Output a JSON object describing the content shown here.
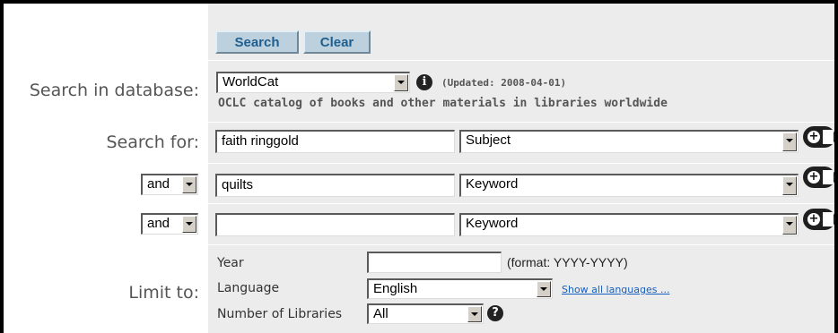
{
  "buttons": {
    "search": "Search",
    "clear": "Clear"
  },
  "database": {
    "label": "Search in database:",
    "selected": "WorldCat",
    "updated": "(Updated: 2008-04-01)",
    "description": "OCLC catalog of books and other materials in libraries worldwide",
    "info_icon": "info-icon"
  },
  "search_rows": [
    {
      "label": "Search for:",
      "term": "faith ringgold",
      "index": "Subject"
    },
    {
      "operator": "and",
      "term": "quilts",
      "index": "Keyword"
    },
    {
      "operator": "and",
      "term": "",
      "index": "Keyword"
    }
  ],
  "limit": {
    "label": "Limit to:",
    "year_label": "Year",
    "year_value": "",
    "year_format": "(format: YYYY-YYYY)",
    "language_label": "Language",
    "language_value": "English",
    "show_all_languages": "Show all languages ...",
    "libraries_label": "Number of Libraries",
    "libraries_value": "All"
  },
  "colors": {
    "button_bg": "#bcd0de",
    "button_text": "#1f5f8f",
    "panel_bg": "#ececec",
    "link": "#1560bd"
  }
}
